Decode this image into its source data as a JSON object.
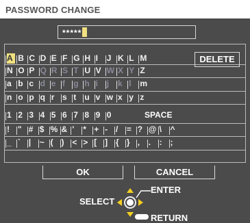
{
  "title": "PASSWORD CHANGE",
  "password": {
    "masked": "*****"
  },
  "keyboard": {
    "rows": [
      [
        "A",
        "B",
        "C",
        "D",
        "E",
        "F",
        "G",
        "H",
        "I",
        "J",
        "K",
        "L",
        "M"
      ],
      [
        "N",
        "O",
        "P",
        "Q",
        "R",
        "S",
        "T",
        "U",
        "V",
        "W",
        "X",
        "Y",
        "Z"
      ],
      [
        "a",
        "b",
        "c",
        "d",
        "e",
        "f",
        "g",
        "h",
        "i",
        "j",
        "k",
        "l",
        "m"
      ],
      [
        "n",
        "o",
        "p",
        "q",
        "r",
        "s",
        "t",
        "u",
        "v",
        "w",
        "x",
        "y",
        "z"
      ],
      [
        "1",
        "2",
        "3",
        "4",
        "5",
        "6",
        "7",
        "8",
        "9",
        "0"
      ],
      [
        "!",
        "\"",
        "#",
        "$",
        "%",
        "&",
        "'",
        "*",
        "+",
        "-",
        "/",
        "=",
        "?",
        "@",
        "\\",
        "^"
      ],
      [
        "_",
        "`",
        "|",
        "~",
        "(",
        ")",
        "<",
        ">",
        "[",
        "]",
        "{",
        "}",
        ",",
        ".",
        ":",
        ";"
      ]
    ],
    "selected": "A",
    "delete_label": "DELETE",
    "space_label": "SPACE"
  },
  "buttons": {
    "ok": "OK",
    "cancel": "CANCEL"
  },
  "legend": {
    "select": "SELECT",
    "enter": "ENTER",
    "return": "RETURN"
  },
  "colors": {
    "background": "#4b4b4b",
    "highlight": "#f0e080",
    "arrow": "#f5d020"
  }
}
